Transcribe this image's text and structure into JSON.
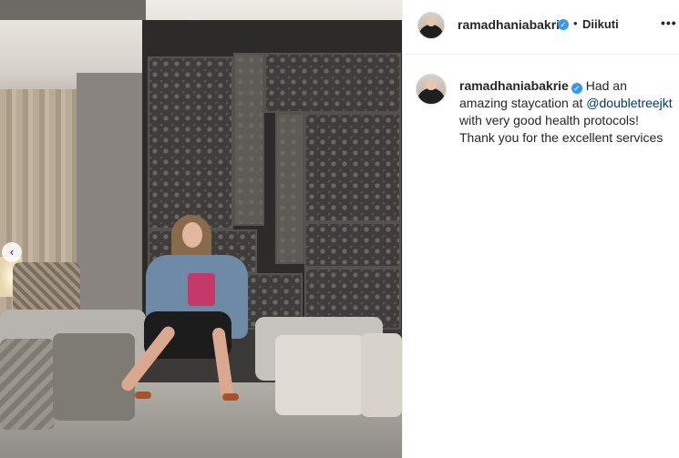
{
  "post": {
    "username": "ramadhaniabakrie",
    "follow_label": "Diikuti",
    "more_label": "•••",
    "dot_separator": "•",
    "verified_glyph": "✓",
    "carousel_prev_glyph": "‹",
    "caption": {
      "text_before": "Had an amazing staycation at ",
      "mention": "@doubletreejkt",
      "text_after": " with very good health protocols! Thank you for the excellent services"
    }
  },
  "icons": {
    "verified": "verified-badge-icon",
    "more": "more-options-icon",
    "carousel_prev": "chevron-left-icon"
  },
  "colors": {
    "verified": "#3897f0",
    "mention": "#00376b",
    "text": "#262626",
    "divider": "#efefef"
  }
}
